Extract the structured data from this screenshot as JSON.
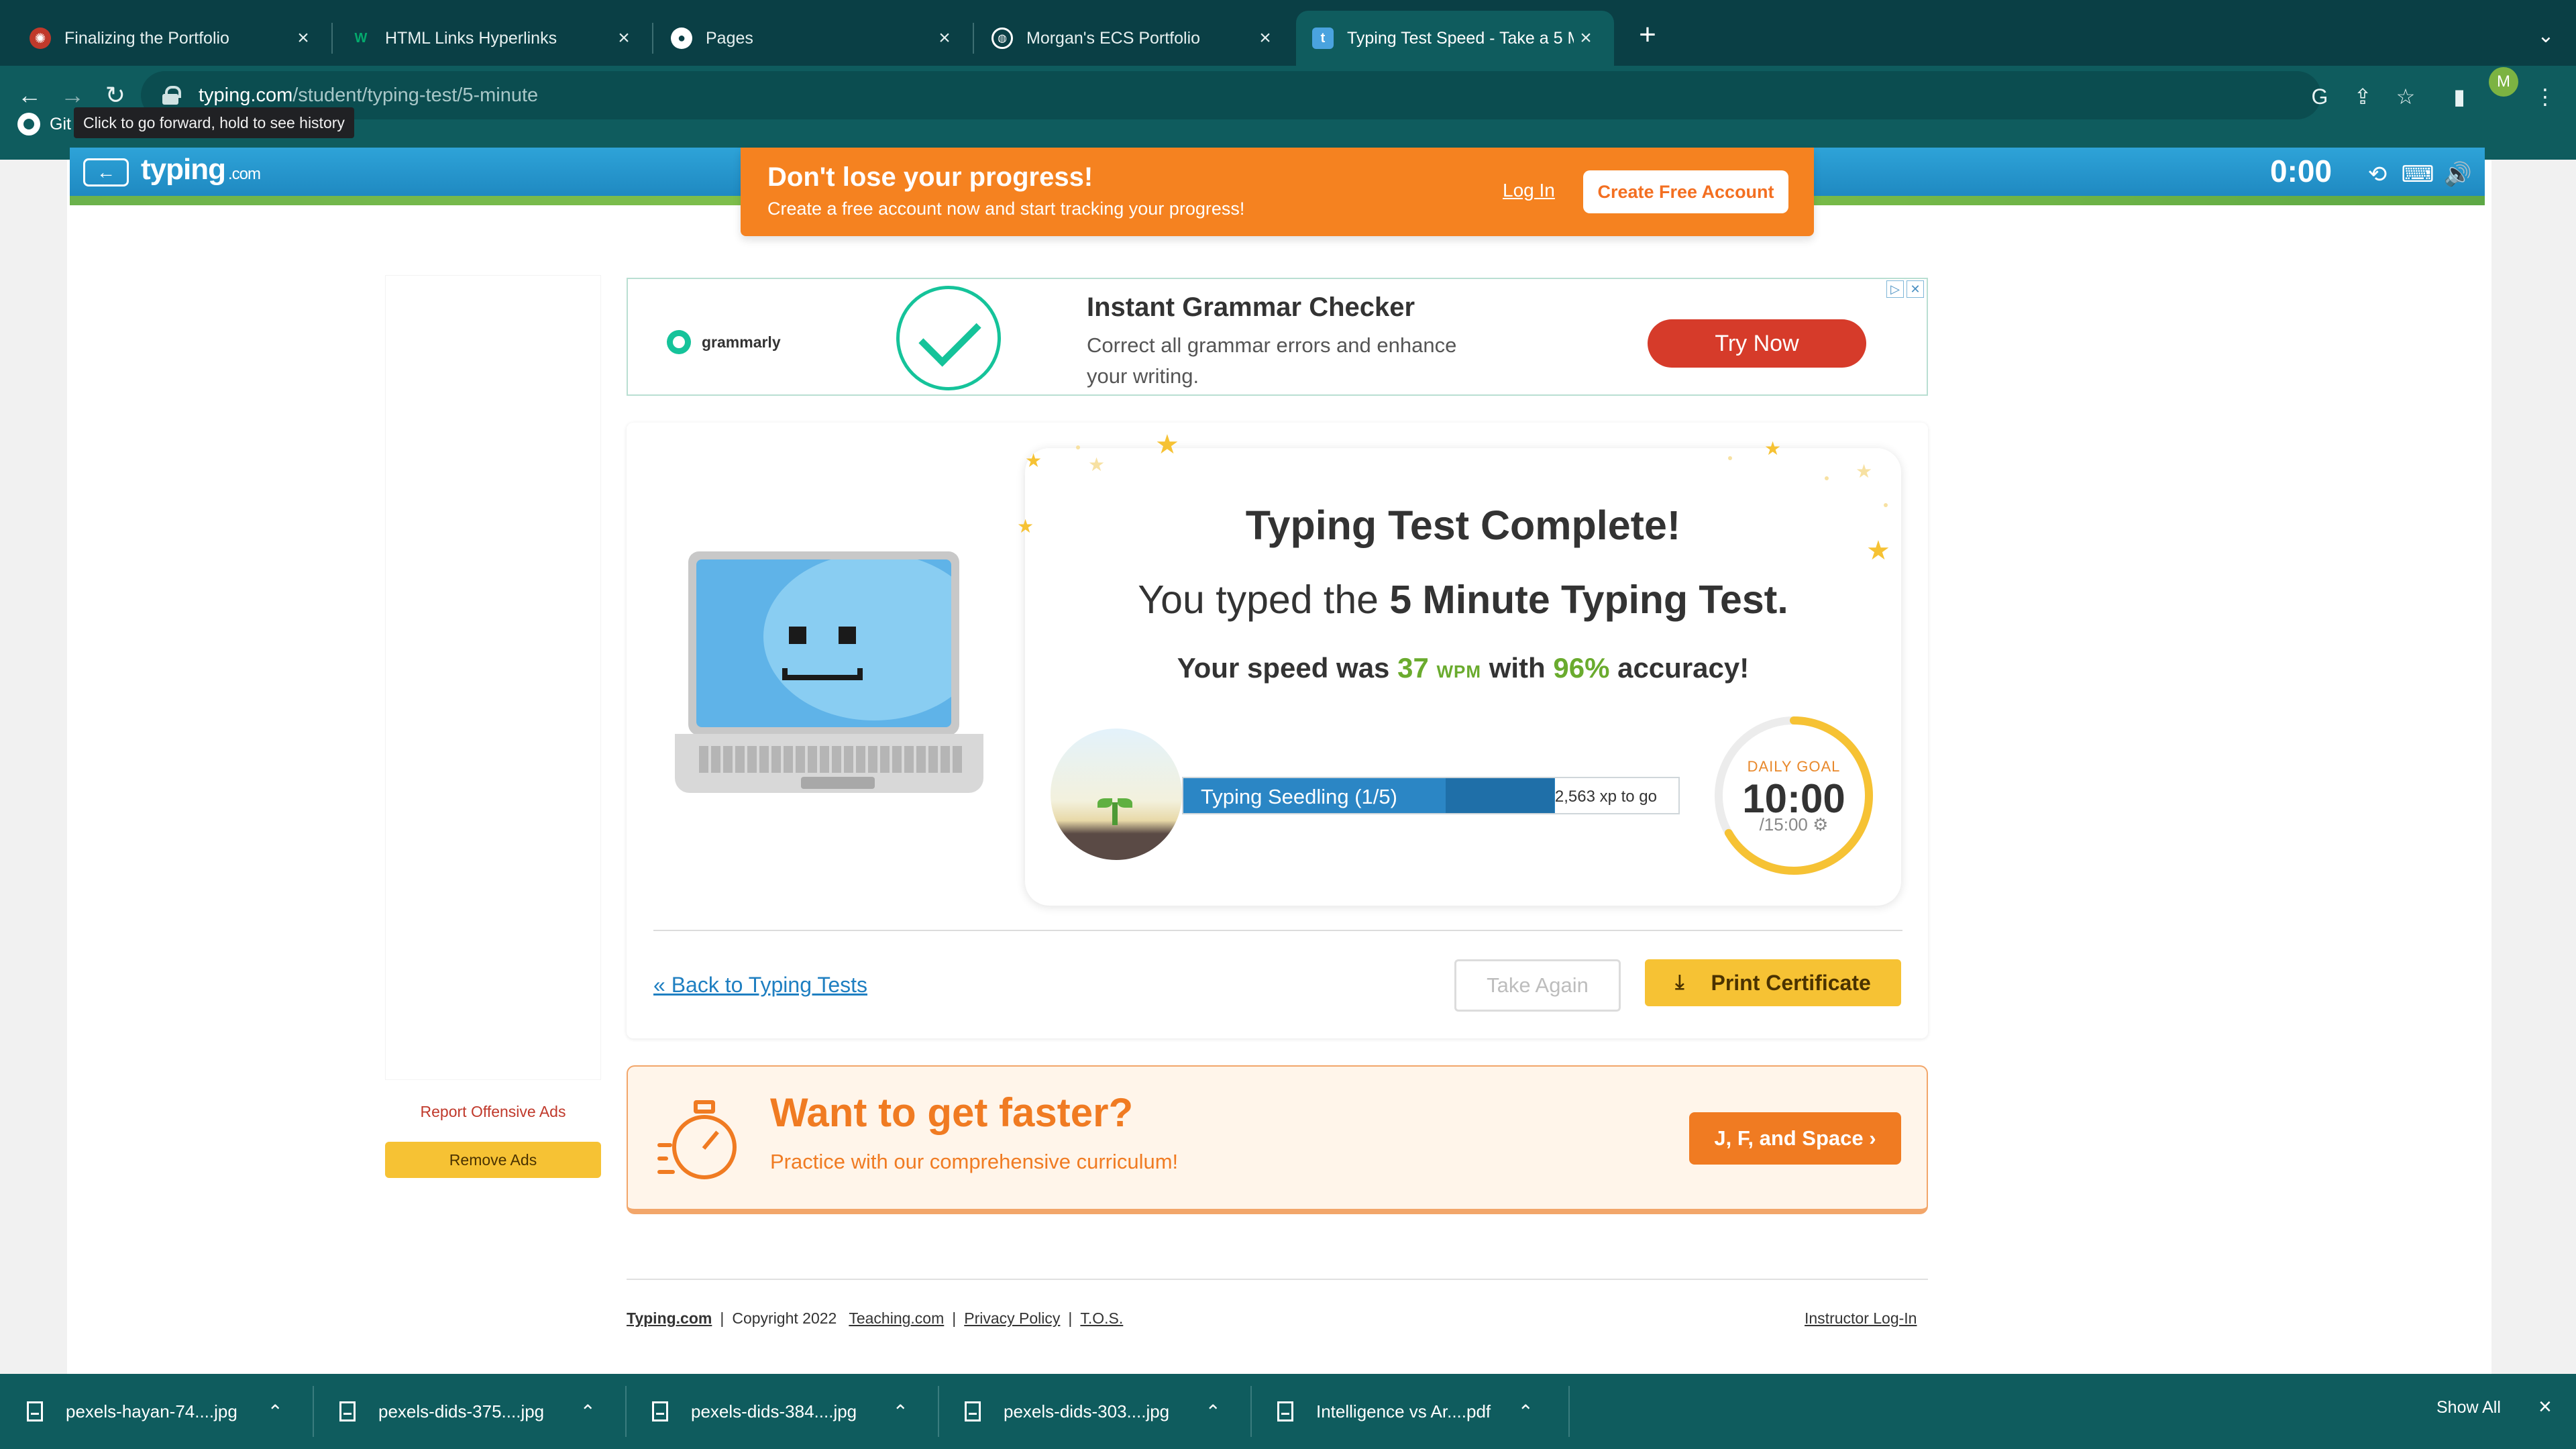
{
  "browser": {
    "tabs": [
      {
        "title": "Finalizing the Portfolio",
        "icon": "portfolio-icon"
      },
      {
        "title": "HTML Links Hyperlinks",
        "icon": "w3schools-icon"
      },
      {
        "title": "Pages",
        "icon": "github-icon"
      },
      {
        "title": "Morgan's ECS Portfolio",
        "icon": "globe-icon"
      },
      {
        "title": "Typing Test Speed - Take a 5 M",
        "icon": "typing-icon",
        "active": true
      }
    ],
    "url_host": "typing.com",
    "url_path": "/student/typing-test/5-minute",
    "bookmark_label": "Git",
    "tooltip": "Click to go forward, hold to see history",
    "profile_initial": "M"
  },
  "site": {
    "logo": "typing",
    "logo_suffix": ".com",
    "timer": "0:00"
  },
  "banner": {
    "title": "Don't lose your progress!",
    "subtitle": "Create a free account now and start tracking your progress!",
    "login": "Log In",
    "create": "Create Free Account"
  },
  "ad": {
    "brand": "grammarly",
    "title": "Instant Grammar Checker",
    "desc": "Correct all grammar errors and enhance your writing.",
    "cta": "Try Now"
  },
  "left_ads": {
    "report": "Report Offensive Ads",
    "remove": "Remove Ads"
  },
  "result": {
    "title": "Typing Test Complete!",
    "line2_prefix": "You typed the ",
    "line2_bold": "5 Minute Typing Test.",
    "speed_prefix": "Your speed was ",
    "wpm_value": "37",
    "wpm_unit": "WPM",
    "with": " with ",
    "accuracy": "96%",
    "accuracy_suffix": " accuracy!",
    "level_label": "Typing Seedling (1/5)",
    "xp_togo": "2,563 xp to go",
    "xp_progress": 0.75,
    "xp_progress_secondary": 0.22,
    "daily_goal_label": "DAILY GOAL",
    "daily_goal_time": "10:00",
    "daily_goal_total": "/15:00",
    "daily_goal_progress": 0.6667,
    "back_link": "« Back to Typing Tests",
    "take_again": "Take Again",
    "print": "Print Certificate"
  },
  "faster": {
    "title": "Want to get faster?",
    "subtitle": "Practice with our comprehensive curriculum!",
    "button": "J, F, and Space ›"
  },
  "footer": {
    "brand": "Typing.com",
    "copyright": "Copyright 2022",
    "teaching": "Teaching.com",
    "privacy": "Privacy Policy",
    "tos": "T.O.S.",
    "instructor": "Instructor Log-In"
  },
  "downloads": {
    "items": [
      "pexels-hayan-74....jpg",
      "pexels-dids-375....jpg",
      "pexels-dids-384....jpg",
      "pexels-dids-303....jpg",
      "Intelligence vs Ar....pdf"
    ],
    "show_all": "Show All"
  },
  "colors": {
    "chrome_tabstrip": "#0a3f45",
    "chrome_toolbar": "#0f5c5e",
    "banner_orange": "#f58220",
    "accent_green": "#6aab2e",
    "accent_yellow": "#f6c234",
    "link_blue": "#1f7fc1"
  }
}
